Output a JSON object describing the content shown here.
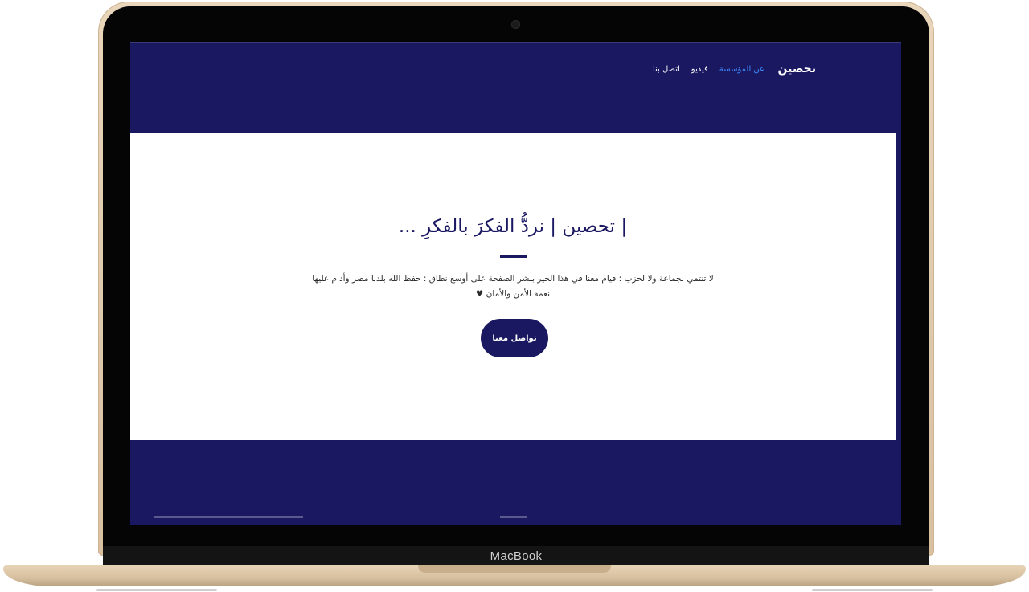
{
  "device": {
    "brand_label": "MacBook"
  },
  "nav": {
    "brand": "تحصين",
    "links": [
      {
        "label": "عن المؤسسة",
        "active": true
      },
      {
        "label": "فيديو",
        "active": false
      },
      {
        "label": "اتصل بنا",
        "active": false
      }
    ]
  },
  "hero": {
    "title": "| تحصين | نردُّ الفكرَ بالفكرِ ...",
    "text": "لا تنتمي لجماعة ولا لحزب : قيام معنا في هذا الخير بنشر الصفحة على أوسع نطاق : حفظ الله بلدنا مصر وأدام عليها نعمة الأمن والأمان ♥",
    "button_label": "تواصل معنا"
  },
  "colors": {
    "primary": "#1b1862",
    "active_link": "#3f8cff",
    "background": "#ffffff"
  }
}
